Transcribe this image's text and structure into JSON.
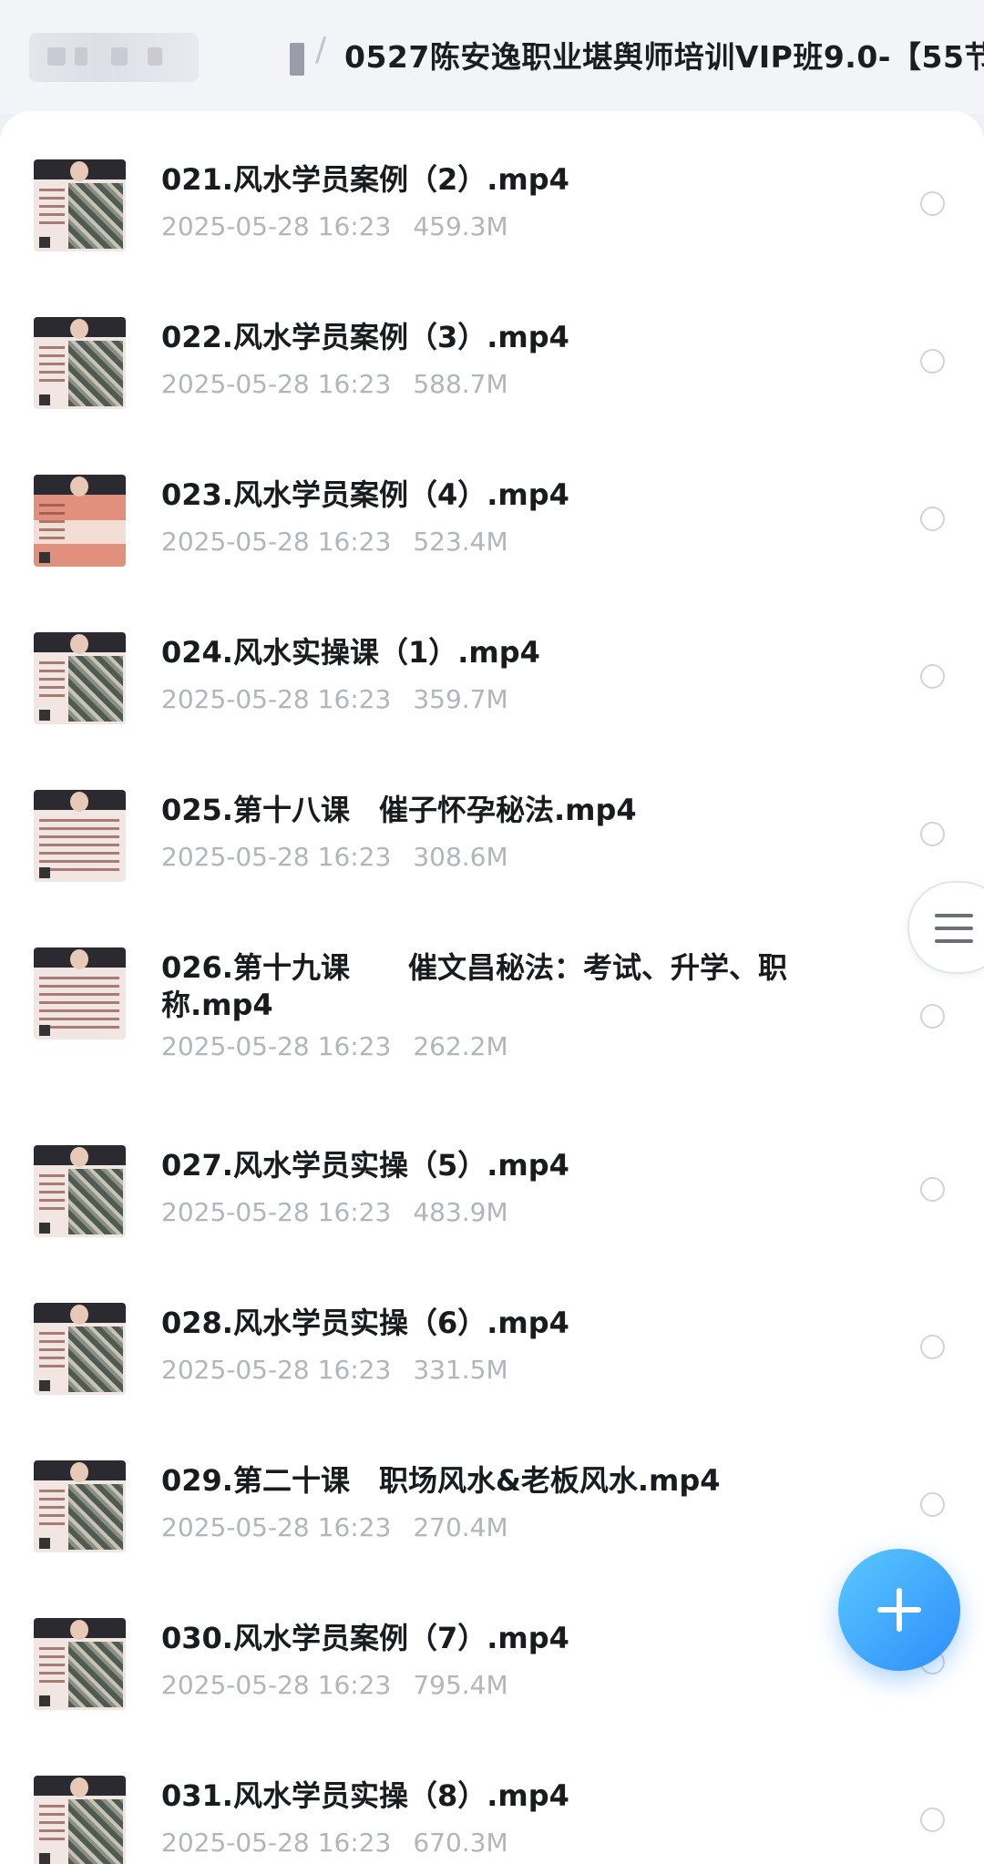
{
  "header": {
    "breadcrumb_separator": "/",
    "folder_title": "0527陈安逸职业堪舆师培训VIP班9.0-【55节"
  },
  "files": [
    {
      "name": "021.风水学员案例（2）.mp4",
      "date": "2025-05-28 16:23",
      "size": "459.3M",
      "thumb": "map"
    },
    {
      "name": "022.风水学员案例（3）.mp4",
      "date": "2025-05-28 16:23",
      "size": "588.7M",
      "thumb": "map"
    },
    {
      "name": "023.风水学员案例（4）.mp4",
      "date": "2025-05-28 16:23",
      "size": "523.4M",
      "thumb": "pink"
    },
    {
      "name": "024.风水实操课（1）.mp4",
      "date": "2025-05-28 16:23",
      "size": "359.7M",
      "thumb": "map"
    },
    {
      "name": "025.第十八课　催子怀孕秘法.mp4",
      "date": "2025-05-28 16:23",
      "size": "308.6M",
      "thumb": "textonly"
    },
    {
      "name": "026.第十九课　　催文昌秘法：考试、升学、职称.mp4",
      "date": "2025-05-28 16:23",
      "size": "262.2M",
      "thumb": "textonly"
    },
    {
      "name": "027.风水学员实操（5）.mp4",
      "date": "2025-05-28 16:23",
      "size": "483.9M",
      "thumb": "map"
    },
    {
      "name": "028.风水学员实操（6）.mp4",
      "date": "2025-05-28 16:23",
      "size": "331.5M",
      "thumb": "map"
    },
    {
      "name": "029.第二十课　职场风水&老板风水.mp4",
      "date": "2025-05-28 16:23",
      "size": "270.4M",
      "thumb": "map"
    },
    {
      "name": "030.风水学员案例（7）.mp4",
      "date": "2025-05-28 16:23",
      "size": "795.4M",
      "thumb": "map"
    },
    {
      "name": "031.风水学员实操（8）.mp4",
      "date": "2025-05-28 16:23",
      "size": "670.3M",
      "thumb": "map"
    }
  ],
  "icons": {
    "side_handle": "menu-icon",
    "fab": "plus-icon"
  },
  "colors": {
    "accent": "#2e8dfb",
    "title_text": "#1a1b1f",
    "meta_text": "#b3b5bc"
  }
}
